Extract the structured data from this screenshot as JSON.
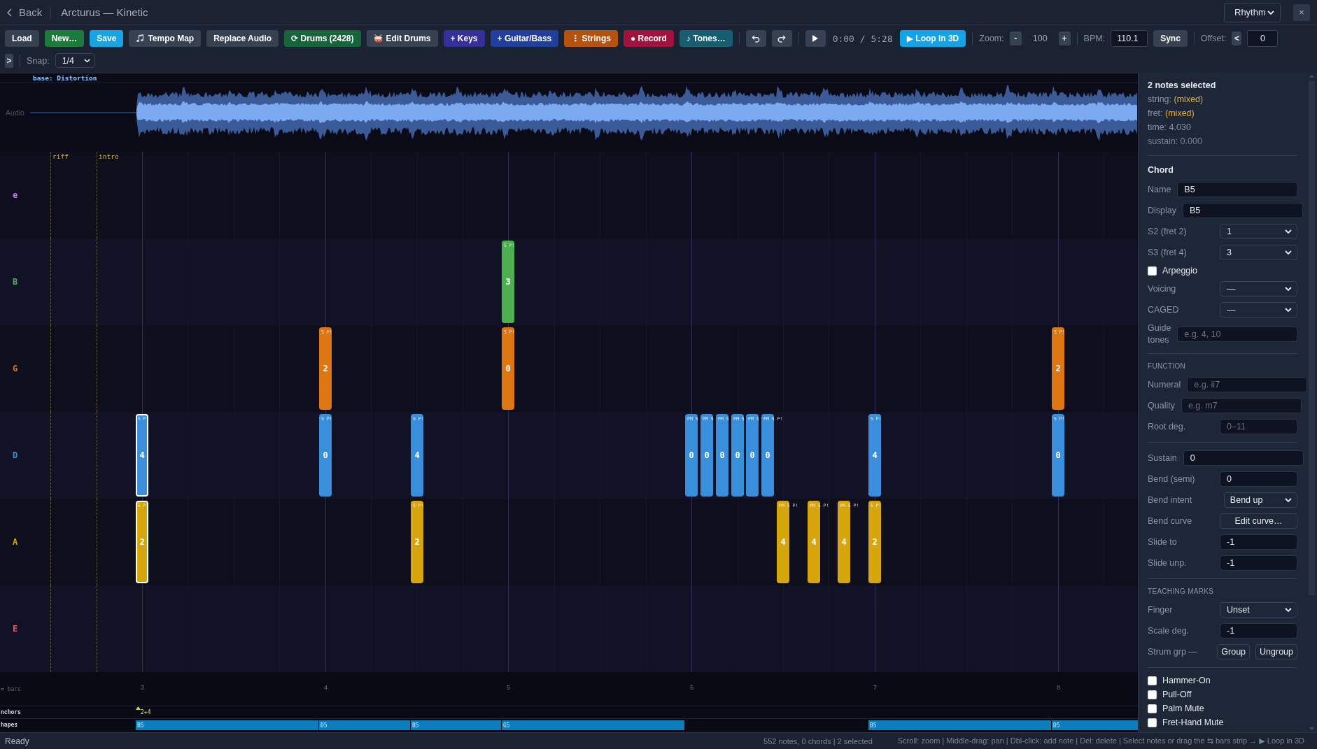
{
  "header": {
    "back": "Back",
    "title": "Arcturus — Kinetic",
    "mode": "Rhythm",
    "close": "×"
  },
  "toolbar": {
    "buttons": [
      {
        "label": "Load",
        "kind": "text",
        "color": "#364152"
      },
      {
        "label": "New…",
        "kind": "text",
        "color": "#1d7a3d"
      },
      {
        "label": "Save",
        "kind": "text",
        "color": "#16a5e4"
      },
      {
        "label": "Tempo Map",
        "kind": "note",
        "color": "#364152"
      },
      {
        "label": "Replace Audio",
        "kind": "text",
        "color": "#364152"
      },
      {
        "label": "⟳ Drums (2428)",
        "kind": "text",
        "color": "#17633a"
      },
      {
        "label": "Edit Drums",
        "kind": "drum",
        "color": "#364152"
      },
      {
        "label": "+ Keys",
        "kind": "text",
        "color": "#35309a"
      },
      {
        "label": "+ Guitar/Bass",
        "kind": "text",
        "color": "#21409e"
      },
      {
        "label": "⋮ Strings",
        "kind": "text",
        "color": "#b4530f"
      },
      {
        "label": "● Record",
        "kind": "text",
        "color": "#a0133f"
      },
      {
        "label": "♪ Tones…",
        "kind": "text",
        "color": "#185e72"
      }
    ],
    "time": "0:00 / 5:28",
    "loop": "▶ Loop in 3D",
    "zoom": {
      "label": "Zoom:",
      "minus": "-",
      "value": "100",
      "plus": "+"
    },
    "bpm": {
      "label": "BPM:",
      "value": "110.1"
    },
    "sync": "Sync",
    "offset": {
      "label": "Offset:",
      "step": "<",
      "value": "0"
    },
    "expand": ">",
    "snap": {
      "label": "Snap:",
      "value": "1/4"
    }
  },
  "timeline": {
    "effect": "base: Distortion",
    "audio_label": "Audio",
    "sections": [
      {
        "label": "riff"
      },
      {
        "label": "intro"
      }
    ],
    "lanes": [
      {
        "string": "e",
        "color": "#c07af5"
      },
      {
        "string": "B",
        "color": "#4caf50",
        "notes": [
          {
            "fret": "3",
            "tags": "S P!",
            "selected": false
          }
        ]
      },
      {
        "string": "G",
        "color": "#de7612",
        "notes": [
          {
            "fret": "2",
            "tags": "S P!",
            "selected": false
          },
          {
            "fret": "0",
            "tags": "S P!",
            "selected": false
          },
          {
            "fret": "2",
            "tags": "S P!",
            "selected": false
          }
        ]
      },
      {
        "string": "D",
        "color": "#3a8fdd",
        "notes": [
          {
            "fret": "4",
            "tags": "S P",
            "selected": true
          },
          {
            "fret": "0",
            "tags": "S P!",
            "selected": false
          },
          {
            "fret": "4",
            "tags": "S P!",
            "selected": false
          },
          {
            "fret": "0",
            "tags": "PM S",
            "selected": false
          },
          {
            "fret": "0",
            "tags": "PM S",
            "selected": false
          },
          {
            "fret": "0",
            "tags": "PM S",
            "selected": false
          },
          {
            "fret": "0",
            "tags": "PM S",
            "selected": false
          },
          {
            "fret": "0",
            "tags": "PM S",
            "selected": false
          },
          {
            "fret": "0",
            "tags": "PM S P!",
            "selected": false
          },
          {
            "fret": "4",
            "tags": "S P!",
            "selected": false
          },
          {
            "fret": "0",
            "tags": "S P!",
            "selected": false
          }
        ]
      },
      {
        "string": "A",
        "color": "#d6a60c",
        "notes": [
          {
            "fret": "2",
            "tags": "S P",
            "selected": true
          },
          {
            "fret": "2",
            "tags": "S P!",
            "selected": false
          },
          {
            "fret": "4",
            "tags": "PM S P!",
            "selected": false
          },
          {
            "fret": "4",
            "tags": "PM S P!",
            "selected": false
          },
          {
            "fret": "4",
            "tags": "PM S P!",
            "selected": false
          },
          {
            "fret": "2",
            "tags": "S P!",
            "selected": false
          }
        ]
      },
      {
        "string": "E",
        "color": "#f05656"
      }
    ],
    "bars_label": "⇆ bars",
    "bars": [
      "3",
      "4",
      "5",
      "6",
      "7",
      "8"
    ],
    "anchors_label": "nchors",
    "anchors": [
      {
        "label": "2+4"
      }
    ],
    "shapes_label": "hapes",
    "shapes": [
      {
        "label": "B5"
      },
      {
        "label": "D5"
      },
      {
        "label": "B5"
      },
      {
        "label": "G5"
      },
      {
        "label": "B5"
      },
      {
        "label": "D5"
      }
    ]
  },
  "inspector": {
    "title": "2 notes selected",
    "summary": [
      {
        "label": "string:",
        "value": "(mixed)",
        "kind": "mixed"
      },
      {
        "label": "fret:",
        "value": "(mixed)",
        "kind": "mixed"
      },
      {
        "label": "time:",
        "value": "4.030",
        "kind": "plain"
      },
      {
        "label": "sustain:",
        "value": "0.000",
        "kind": "dim"
      }
    ],
    "sections": [
      {
        "heading": "Chord",
        "kind": "title",
        "fields": [
          {
            "label": "Name",
            "kind": "text",
            "value": "B5"
          },
          {
            "label": "Display",
            "kind": "text",
            "value": "B5"
          },
          {
            "label": "S2 (fret 2)",
            "kind": "select",
            "value": "1"
          },
          {
            "label": "S3 (fret 4)",
            "kind": "select",
            "value": "3"
          },
          {
            "label": "Arpeggio",
            "kind": "check",
            "checked": false
          },
          {
            "label": "Voicing",
            "kind": "select",
            "value": "—"
          },
          {
            "label": "CAGED",
            "kind": "select",
            "value": "—"
          },
          {
            "label": "Guide tones",
            "kind": "text",
            "placeholder": "e.g. 4, 10"
          }
        ]
      },
      {
        "heading": "FUNCTION",
        "kind": "caps",
        "fields": [
          {
            "label": "Numeral",
            "kind": "text",
            "placeholder": "e.g. ii7"
          },
          {
            "label": "Quality",
            "kind": "text",
            "placeholder": "e.g. m7"
          },
          {
            "label": "Root deg.",
            "kind": "short",
            "placeholder": "0–11"
          }
        ]
      },
      {
        "fields": [
          {
            "label": "Sustain",
            "kind": "text",
            "value": "0"
          },
          {
            "label": "Bend (semi)",
            "kind": "short",
            "value": "0"
          },
          {
            "label": "Bend intent",
            "kind": "wide",
            "value": "Bend up"
          },
          {
            "label": "Bend curve",
            "kind": "button",
            "value": "Edit curve…"
          },
          {
            "label": "Slide to",
            "kind": "short",
            "value": "-1"
          },
          {
            "label": "Slide unp.",
            "kind": "short",
            "value": "-1"
          }
        ]
      },
      {
        "heading": "TEACHING MARKS",
        "kind": "caps",
        "fields": [
          {
            "label": "Finger",
            "kind": "select",
            "value": "Unset"
          },
          {
            "label": "Scale deg.",
            "kind": "short",
            "value": "-1"
          },
          {
            "label": "Strum grp —",
            "kind": "buttons",
            "buttons": [
              "Group",
              "Ungroup"
            ]
          }
        ]
      },
      {
        "fields": [
          {
            "label": "Hammer-On",
            "kind": "check",
            "checked": false
          },
          {
            "label": "Pull-Off",
            "kind": "check",
            "checked": false
          },
          {
            "label": "Palm Mute",
            "kind": "check",
            "checked": false
          },
          {
            "label": "Fret-Hand Mute",
            "kind": "check",
            "checked": false
          }
        ]
      }
    ]
  },
  "status_bar": {
    "state": "Ready",
    "counts": "552 notes, 0 chords | 2 selected",
    "hints": "Scroll: zoom | Middle-drag: pan | Dbl-click: add note | Del: delete | Select notes or drag the ⇆ bars strip → ▶ Loop in 3D"
  }
}
